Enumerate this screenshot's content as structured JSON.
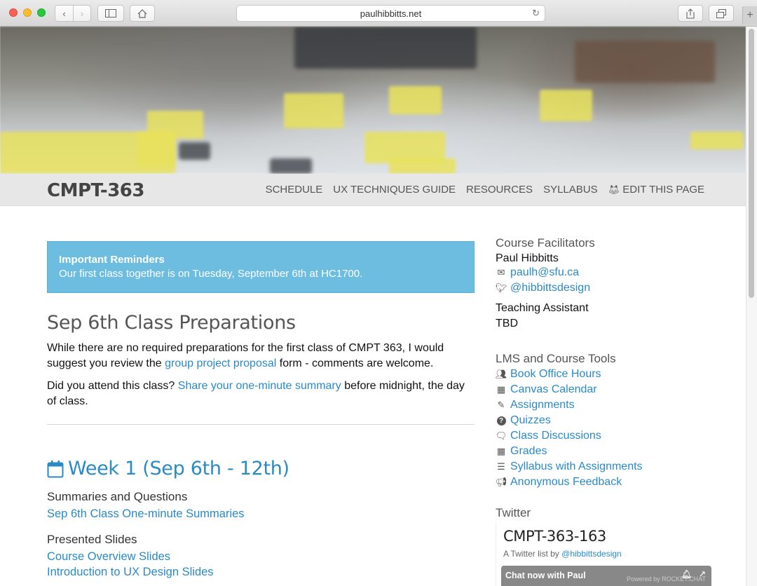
{
  "browser": {
    "url": "paulhibbitts.net"
  },
  "header": {
    "brand": "CMPT-363",
    "nav": [
      "SCHEDULE",
      "UX TECHNIQUES GUIDE",
      "RESOURCES",
      "SYLLABUS",
      "EDIT THIS PAGE"
    ]
  },
  "alert": {
    "title": "Important Reminders",
    "text": "Our first class together is on Tuesday, September 6th at HC1700."
  },
  "prep": {
    "heading": "Sep 6th Class Preparations",
    "p1_before": "While there are no required preparations for the first class of CMPT 363, I would suggest you review the ",
    "p1_link": "group project proposal",
    "p1_after": " form - comments are welcome.",
    "p2_before": "Did you attend this class? ",
    "p2_link": "Share your one-minute summary",
    "p2_after": " before midnight, the day of class."
  },
  "week": {
    "title": "Week 1 (Sep 6th - 12th)",
    "summaries_heading": "Summaries and Questions",
    "summaries_link": "Sep 6th Class One-minute Summaries",
    "slides_heading": "Presented Slides",
    "slides_links": [
      "Course Overview Slides",
      "Introduction to UX Design Slides"
    ]
  },
  "sidebar": {
    "facilitators_heading": "Course Facilitators",
    "facilitator_name": "Paul Hibbitts",
    "email": "paulh@sfu.ca",
    "twitter_handle": "@hibbittsdesign",
    "ta_label": "Teaching Assistant",
    "ta_name": "TBD",
    "lms_heading": "LMS and Course Tools",
    "tools": [
      {
        "label": "Book Office Hours",
        "icon": "users-icon"
      },
      {
        "label": "Canvas Calendar",
        "icon": "calendar-icon"
      },
      {
        "label": "Assignments",
        "icon": "pencil-icon"
      },
      {
        "label": "Quizzes",
        "icon": "question-circle-icon"
      },
      {
        "label": "Class Discussions",
        "icon": "comments-icon"
      },
      {
        "label": "Grades",
        "icon": "calculator-icon"
      },
      {
        "label": "Syllabus with Assignments",
        "icon": "list-icon"
      },
      {
        "label": "Anonymous Feedback",
        "icon": "bullhorn-icon"
      }
    ],
    "twitter_heading": "Twitter",
    "twitter_list_title": "CMPT-363-163",
    "twitter_list_by": "A Twitter list by ",
    "twitter_list_owner": "@hibbittsdesign"
  },
  "chat": {
    "label": "Chat now with Paul",
    "powered": "Powered by ROCKET.CHAT"
  }
}
